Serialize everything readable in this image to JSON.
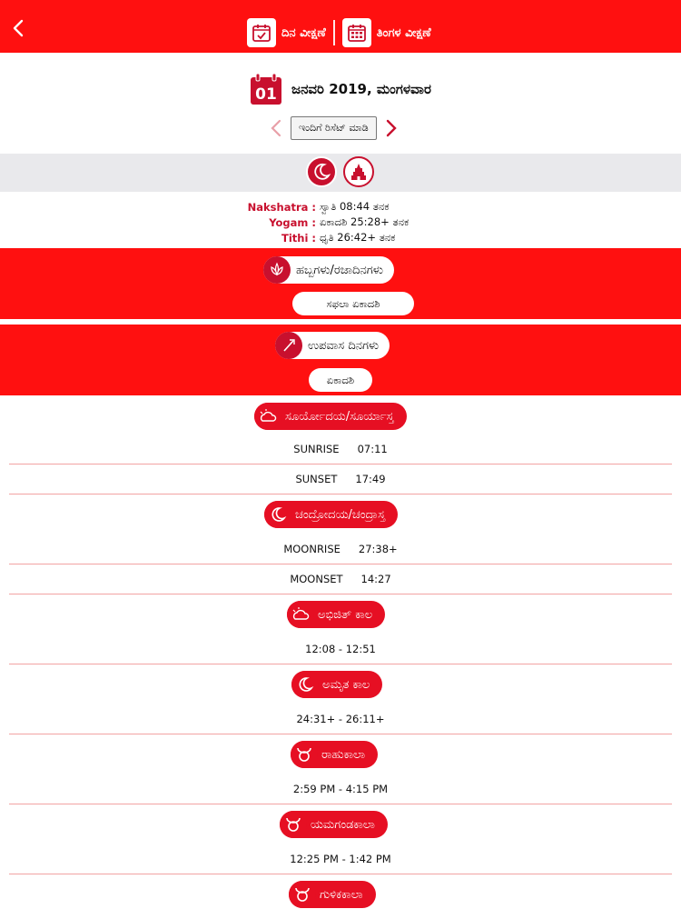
{
  "header": {
    "back_icon": "chevron-left-icon",
    "tab_day_label": "ದಿನ ವೀಕ್ಷಣೆ",
    "tab_month_label": "ತಿಂಗಳ ವೀಕ್ಷಣೆ",
    "colors": {
      "bar": "#ff1010"
    }
  },
  "date": {
    "day_number": "01",
    "text": "ಜನವರಿ 2019, ಮಂಗಳವಾರ",
    "reset_label": "ಇಂದಿಗೆ ರಿಸೆಟ್ ಮಾಡಿ"
  },
  "panchang": {
    "nakshatra_key": "Nakshatra",
    "nakshatra_val": "ಸ್ವಾತಿ 08:44 ತನಕ",
    "yogam_key": "Yogam",
    "yogam_val": "ಏಕಾದಶಿ 25:28+ ತನಕ",
    "tithi_key": "Tithi",
    "tithi_val": "ಧೃತಿ 26:42+ ತನಕ"
  },
  "festivals": {
    "title": "ಹಬ್ಬಗಳು/ರಜಾದಿನಗಳು",
    "value": "ಸಫಲಾ ಏಕಾದಶಿ"
  },
  "fasting": {
    "title": "ಉಪವಾಸ ದಿನಗಳು",
    "value": "ಏಕಾದಶಿ"
  },
  "sun": {
    "title": "ಸೂರ್ಯೋದಯ/ಸೂರ್ಯಾಸ್ತ",
    "sunrise_label": "SUNRISE",
    "sunrise": "07:11",
    "sunset_label": "SUNSET",
    "sunset": "17:49"
  },
  "moon": {
    "title": "ಚಂದ್ರೋದಯ/ಚಂದ್ರಾಸ್ತ",
    "moonrise_label": "MOONRISE",
    "moonrise": "27:38+",
    "moonset_label": "MOONSET",
    "moonset": "14:27"
  },
  "abhijit": {
    "title": "ಅಭಿಜಿತ್ ಕಾಲ",
    "value": "12:08 - 12:51"
  },
  "amrita": {
    "title": "ಅಮೃತ ಕಾಲ",
    "value": "24:31+ - 26:11+"
  },
  "rahu": {
    "title": "ರಾಹುಕಾಲಾ",
    "value": "2:59 PM - 4:15 PM"
  },
  "yama": {
    "title": "ಯಮಗಂಡಕಾಲಾ",
    "value": "12:25 PM - 1:42 PM"
  },
  "gulika": {
    "title": "ಗುಳಿಕಕಾಲಾ"
  }
}
